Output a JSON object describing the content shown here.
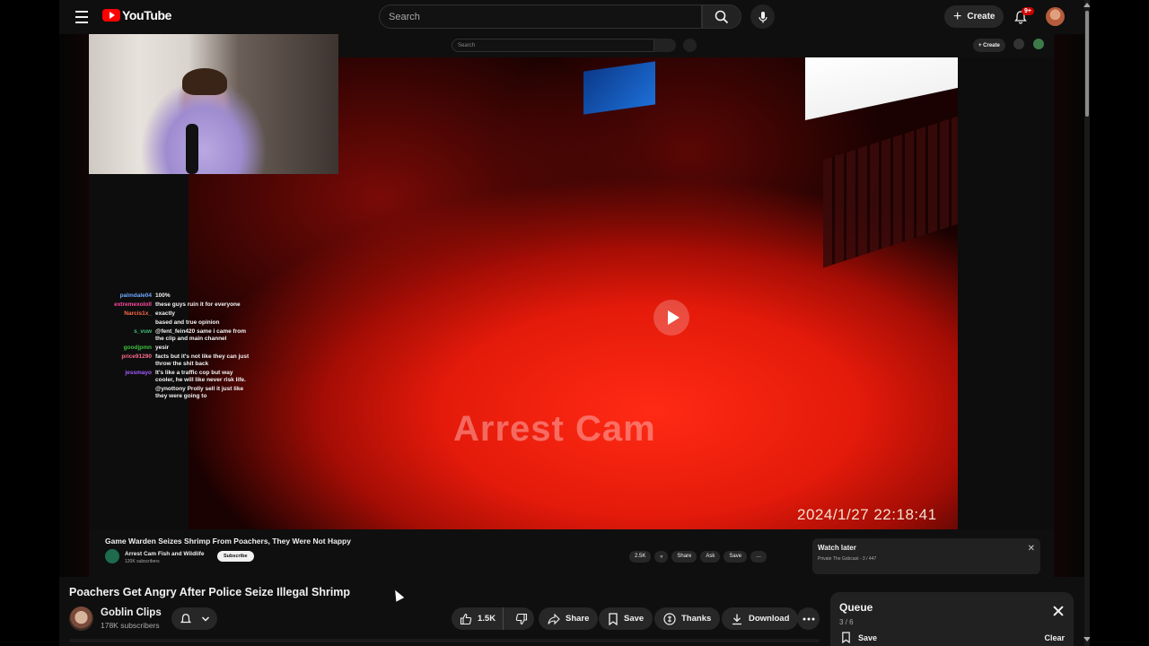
{
  "header": {
    "logo_text": "YouTube",
    "search_placeholder": "Search",
    "create_label": "Create",
    "notification_badge": "9+"
  },
  "embedded": {
    "search_placeholder": "Search",
    "create_label": "Create",
    "chat": [
      {
        "user": "palmdale04",
        "color": "#6fa8ff",
        "message": "100%"
      },
      {
        "user": "extremexololl",
        "color": "#ff4aa0",
        "message": "these guys ruin it for everyone"
      },
      {
        "user": "Narcis1x_",
        "color": "#ff6a4a",
        "message": "exactly"
      },
      {
        "user": "",
        "color": "#4a6aff",
        "message": "based and true opinion"
      },
      {
        "user": "s_vuw",
        "color": "#3fc07a",
        "message": "@fent_fein420 same i came from the clip and main channel"
      },
      {
        "user": "goodjpmn",
        "color": "#3fc03f",
        "message": "yesir"
      },
      {
        "user": "price91290",
        "color": "#ff6a8a",
        "message": "facts but it's not like they can just throw the shit back"
      },
      {
        "user": "jessmayo",
        "color": "#a45cff",
        "message": "It's like a traffic cop but way cooler, he will like never risk life."
      },
      {
        "user": "",
        "color": "#ff3a3a",
        "message": "@ynottony Prolly sell it just like they were going to"
      }
    ],
    "watermark": "Arrest Cam",
    "timestamp": "2024/1/27   22:18:41",
    "video_title": "Game Warden Seizes Shrimp From Poachers, They Were Not Happy",
    "channel_name": "Arrest Cam Fish and Wildlife",
    "channel_subs": "120K subscribers",
    "subscribe_label": "Subscribe",
    "actions": [
      "2.5K",
      "",
      "Share",
      "Ask",
      "Save",
      "…"
    ],
    "watch_later_title": "Watch later",
    "watch_later_sub": "Private The Gobcast - 3 / 447"
  },
  "video": {
    "title": "Poachers Get Angry After Police Seize Illegal Shrimp",
    "channel": "Goblin Clips",
    "subscribers": "178K subscribers",
    "like_count": "1.5K",
    "share_label": "Share",
    "save_label": "Save",
    "thanks_label": "Thanks",
    "download_label": "Download"
  },
  "queue": {
    "title": "Queue",
    "count": "3 / 6",
    "save_label": "Save",
    "clear_label": "Clear"
  },
  "colors": {
    "brand_red": "#ff0000",
    "background": "#0f0f0f",
    "pill": "#272727"
  }
}
